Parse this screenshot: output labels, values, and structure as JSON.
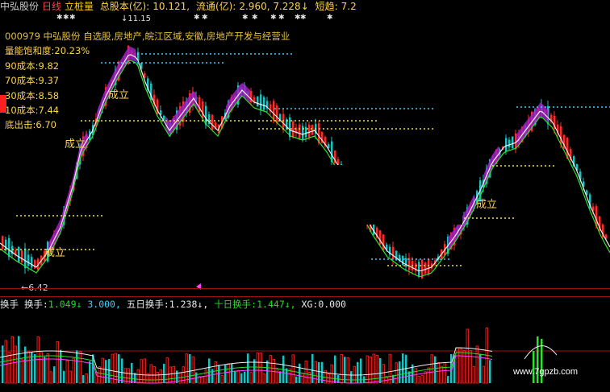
{
  "header": {
    "stock_name": "中弘股份",
    "period": "日线",
    "indicator": "立桩量",
    "total_share_label": "总股本(亿):",
    "total_share_value": "10.121,",
    "float_label": "流通(亿):",
    "float_value": "2.960, 7.228↓",
    "short_label": "短趋:",
    "short_value": "7.2"
  },
  "info_panel": {
    "title": "000979 中弘股份 自选股,房地产,皖江区域,安徽,房地产开发与经营业",
    "lines": [
      "量能饱和度:20.23%",
      "90成本:9.82",
      "70成本:9.37",
      "30成本:8.58",
      "10成本:7.44",
      "底出击:6.70"
    ]
  },
  "labels": {
    "chengli": "成立",
    "low_marker": "←6.42",
    "top_marker": "11.15"
  },
  "volume_panel": {
    "name": "换手",
    "turnover_label": "换手:",
    "turnover_value": "1.049↓",
    "turnover_ma": "3.000,",
    "five_day_label": "五日换手:",
    "five_day_value": "1.238↓,",
    "ten_day_label": "十日换手:",
    "ten_day_value": "1.447↓,",
    "xg_label": "XG:",
    "xg_value": "0.000"
  },
  "watermark": "www.7gpzb.com",
  "colors": {
    "up": "#ff2a2a",
    "down": "#20c0c0",
    "purple_band": "#a020c0",
    "ma_white": "#f0f0f0",
    "ma_green": "#30e030",
    "cost_cyan": "#40c8ff",
    "cost_yellow": "#f0e040",
    "axis_red": "#a01010"
  }
}
